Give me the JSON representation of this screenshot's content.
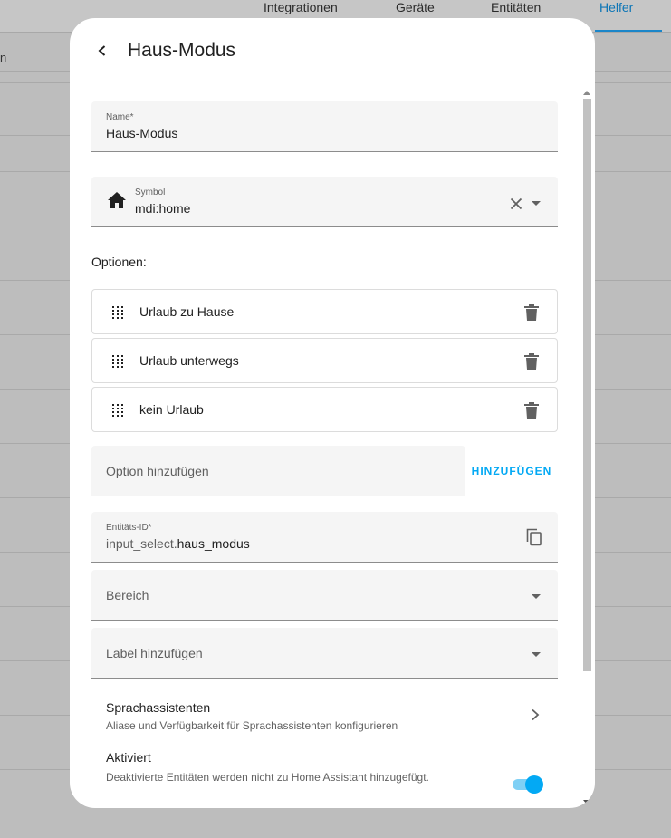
{
  "background": {
    "tabs": [
      {
        "label": "Integrationen"
      },
      {
        "label": "Geräte"
      },
      {
        "label": "Entitäten"
      },
      {
        "label": "Helfer"
      }
    ],
    "cut_text": "n"
  },
  "colors": {
    "accent": "#03a9f4",
    "field_background": "#f5f5f5",
    "text_primary": "#212121",
    "text_secondary": "#616161"
  },
  "dialog": {
    "title": "Haus-Modus",
    "back_icon": "chevron-left-icon",
    "name_field": {
      "label": "Name*",
      "value": "Haus-Modus"
    },
    "symbol_field": {
      "label": "Symbol",
      "value": "mdi:home",
      "icon": "home-icon"
    },
    "options_label": "Optionen:",
    "options": [
      {
        "label": "Urlaub zu Hause"
      },
      {
        "label": "Urlaub unterwegs"
      },
      {
        "label": "kein Urlaub"
      }
    ],
    "add_option": {
      "placeholder": "Option hinzufügen",
      "button_label": "HINZUFÜGEN"
    },
    "entity_id_field": {
      "label": "Entitäts-ID*",
      "prefix": "input_select.",
      "value": "haus_modus"
    },
    "area_field": {
      "placeholder": "Bereich"
    },
    "label_field": {
      "placeholder": "Label hinzufügen"
    },
    "voice_assistants": {
      "title": "Sprachassistenten",
      "subtitle": "Aliase und Verfügbarkeit für Sprachassistenten konfigurieren"
    },
    "enabled": {
      "title": "Aktiviert",
      "subtitle": "Deaktivierte Entitäten werden nicht zu Home Assistant hinzugefügt.",
      "on": true
    }
  }
}
